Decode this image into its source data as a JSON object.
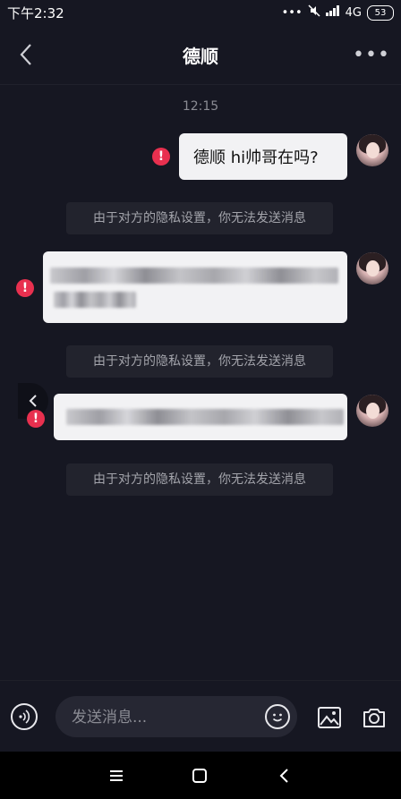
{
  "status_bar": {
    "time": "下午2:32",
    "network": "4G",
    "battery": "53"
  },
  "header": {
    "title": "德顺"
  },
  "chat": {
    "timestamp": "12:15",
    "messages": [
      {
        "text": "德顺 hi帅哥在吗?",
        "status": "failed"
      },
      {
        "text": "",
        "status": "failed",
        "blurred": true
      },
      {
        "text": "",
        "status": "failed",
        "blurred": true
      }
    ],
    "system_notes": [
      "由于对方的隐私设置，你无法发送消息",
      "由于对方的隐私设置，你无法发送消息",
      "由于对方的隐私设置，你无法发送消息"
    ]
  },
  "composer": {
    "placeholder": "发送消息..."
  },
  "icons": {
    "back": "chevron-left-icon",
    "more": "more-icon",
    "error": "error-icon",
    "voice": "voice-icon",
    "emoji": "emoji-icon",
    "image": "image-icon",
    "camera": "camera-icon",
    "nav_menu": "menu-icon",
    "nav_home": "home-icon",
    "nav_back": "back-icon"
  },
  "colors": {
    "background": "#161722",
    "bubble": "#f2f2f4",
    "error": "#e8304f",
    "system_note": "#22232d"
  }
}
